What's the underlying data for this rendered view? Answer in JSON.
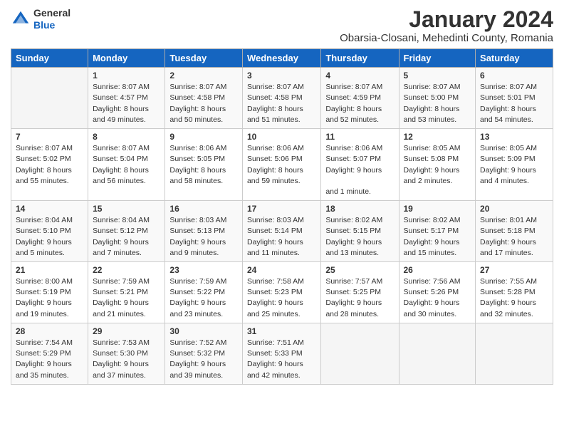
{
  "header": {
    "logo_general": "General",
    "logo_blue": "Blue",
    "month_year": "January 2024",
    "location": "Obarsia-Closani, Mehedinti County, Romania"
  },
  "weekdays": [
    "Sunday",
    "Monday",
    "Tuesday",
    "Wednesday",
    "Thursday",
    "Friday",
    "Saturday"
  ],
  "weeks": [
    [
      {
        "day": "",
        "sunrise": "",
        "sunset": "",
        "daylight": ""
      },
      {
        "day": "1",
        "sunrise": "Sunrise: 8:07 AM",
        "sunset": "Sunset: 4:57 PM",
        "daylight": "Daylight: 8 hours and 49 minutes."
      },
      {
        "day": "2",
        "sunrise": "Sunrise: 8:07 AM",
        "sunset": "Sunset: 4:58 PM",
        "daylight": "Daylight: 8 hours and 50 minutes."
      },
      {
        "day": "3",
        "sunrise": "Sunrise: 8:07 AM",
        "sunset": "Sunset: 4:58 PM",
        "daylight": "Daylight: 8 hours and 51 minutes."
      },
      {
        "day": "4",
        "sunrise": "Sunrise: 8:07 AM",
        "sunset": "Sunset: 4:59 PM",
        "daylight": "Daylight: 8 hours and 52 minutes."
      },
      {
        "day": "5",
        "sunrise": "Sunrise: 8:07 AM",
        "sunset": "Sunset: 5:00 PM",
        "daylight": "Daylight: 8 hours and 53 minutes."
      },
      {
        "day": "6",
        "sunrise": "Sunrise: 8:07 AM",
        "sunset": "Sunset: 5:01 PM",
        "daylight": "Daylight: 8 hours and 54 minutes."
      }
    ],
    [
      {
        "day": "7",
        "sunrise": "Sunrise: 8:07 AM",
        "sunset": "Sunset: 5:02 PM",
        "daylight": "Daylight: 8 hours and 55 minutes."
      },
      {
        "day": "8",
        "sunrise": "Sunrise: 8:07 AM",
        "sunset": "Sunset: 5:04 PM",
        "daylight": "Daylight: 8 hours and 56 minutes."
      },
      {
        "day": "9",
        "sunrise": "Sunrise: 8:06 AM",
        "sunset": "Sunset: 5:05 PM",
        "daylight": "Daylight: 8 hours and 58 minutes."
      },
      {
        "day": "10",
        "sunrise": "Sunrise: 8:06 AM",
        "sunset": "Sunset: 5:06 PM",
        "daylight": "Daylight: 8 hours and 59 minutes."
      },
      {
        "day": "11",
        "sunrise": "Sunrise: 8:06 AM",
        "sunset": "Sunset: 5:07 PM",
        "daylight": "Daylight: 9 hours and 1 minute."
      },
      {
        "day": "12",
        "sunrise": "Sunrise: 8:05 AM",
        "sunset": "Sunset: 5:08 PM",
        "daylight": "Daylight: 9 hours and 2 minutes."
      },
      {
        "day": "13",
        "sunrise": "Sunrise: 8:05 AM",
        "sunset": "Sunset: 5:09 PM",
        "daylight": "Daylight: 9 hours and 4 minutes."
      }
    ],
    [
      {
        "day": "14",
        "sunrise": "Sunrise: 8:04 AM",
        "sunset": "Sunset: 5:10 PM",
        "daylight": "Daylight: 9 hours and 5 minutes."
      },
      {
        "day": "15",
        "sunrise": "Sunrise: 8:04 AM",
        "sunset": "Sunset: 5:12 PM",
        "daylight": "Daylight: 9 hours and 7 minutes."
      },
      {
        "day": "16",
        "sunrise": "Sunrise: 8:03 AM",
        "sunset": "Sunset: 5:13 PM",
        "daylight": "Daylight: 9 hours and 9 minutes."
      },
      {
        "day": "17",
        "sunrise": "Sunrise: 8:03 AM",
        "sunset": "Sunset: 5:14 PM",
        "daylight": "Daylight: 9 hours and 11 minutes."
      },
      {
        "day": "18",
        "sunrise": "Sunrise: 8:02 AM",
        "sunset": "Sunset: 5:15 PM",
        "daylight": "Daylight: 9 hours and 13 minutes."
      },
      {
        "day": "19",
        "sunrise": "Sunrise: 8:02 AM",
        "sunset": "Sunset: 5:17 PM",
        "daylight": "Daylight: 9 hours and 15 minutes."
      },
      {
        "day": "20",
        "sunrise": "Sunrise: 8:01 AM",
        "sunset": "Sunset: 5:18 PM",
        "daylight": "Daylight: 9 hours and 17 minutes."
      }
    ],
    [
      {
        "day": "21",
        "sunrise": "Sunrise: 8:00 AM",
        "sunset": "Sunset: 5:19 PM",
        "daylight": "Daylight: 9 hours and 19 minutes."
      },
      {
        "day": "22",
        "sunrise": "Sunrise: 7:59 AM",
        "sunset": "Sunset: 5:21 PM",
        "daylight": "Daylight: 9 hours and 21 minutes."
      },
      {
        "day": "23",
        "sunrise": "Sunrise: 7:59 AM",
        "sunset": "Sunset: 5:22 PM",
        "daylight": "Daylight: 9 hours and 23 minutes."
      },
      {
        "day": "24",
        "sunrise": "Sunrise: 7:58 AM",
        "sunset": "Sunset: 5:23 PM",
        "daylight": "Daylight: 9 hours and 25 minutes."
      },
      {
        "day": "25",
        "sunrise": "Sunrise: 7:57 AM",
        "sunset": "Sunset: 5:25 PM",
        "daylight": "Daylight: 9 hours and 28 minutes."
      },
      {
        "day": "26",
        "sunrise": "Sunrise: 7:56 AM",
        "sunset": "Sunset: 5:26 PM",
        "daylight": "Daylight: 9 hours and 30 minutes."
      },
      {
        "day": "27",
        "sunrise": "Sunrise: 7:55 AM",
        "sunset": "Sunset: 5:28 PM",
        "daylight": "Daylight: 9 hours and 32 minutes."
      }
    ],
    [
      {
        "day": "28",
        "sunrise": "Sunrise: 7:54 AM",
        "sunset": "Sunset: 5:29 PM",
        "daylight": "Daylight: 9 hours and 35 minutes."
      },
      {
        "day": "29",
        "sunrise": "Sunrise: 7:53 AM",
        "sunset": "Sunset: 5:30 PM",
        "daylight": "Daylight: 9 hours and 37 minutes."
      },
      {
        "day": "30",
        "sunrise": "Sunrise: 7:52 AM",
        "sunset": "Sunset: 5:32 PM",
        "daylight": "Daylight: 9 hours and 39 minutes."
      },
      {
        "day": "31",
        "sunrise": "Sunrise: 7:51 AM",
        "sunset": "Sunset: 5:33 PM",
        "daylight": "Daylight: 9 hours and 42 minutes."
      },
      {
        "day": "",
        "sunrise": "",
        "sunset": "",
        "daylight": ""
      },
      {
        "day": "",
        "sunrise": "",
        "sunset": "",
        "daylight": ""
      },
      {
        "day": "",
        "sunrise": "",
        "sunset": "",
        "daylight": ""
      }
    ]
  ]
}
